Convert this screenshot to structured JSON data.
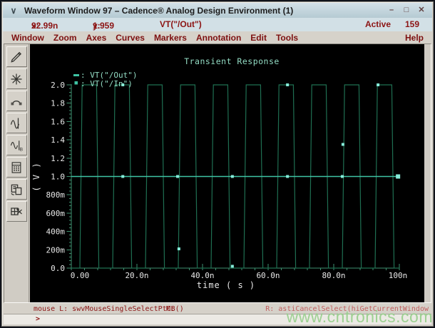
{
  "window": {
    "title": "Waveform Window 97 – Cadence® Analog Design Environment (1)",
    "controls": {
      "menu": "∨",
      "minimize": "–",
      "maximize": "□",
      "close": "✕"
    }
  },
  "readout": {
    "x_label": "x:",
    "x_value": "92.99n",
    "y_label": "y:",
    "y_value": "1.959",
    "signal": "VT(\"/Out\")",
    "active_label": "Active",
    "active_count": "159"
  },
  "menubar": {
    "items": [
      "Window",
      "Zoom",
      "Axes",
      "Curves",
      "Markers",
      "Annotation",
      "Edit",
      "Tools"
    ],
    "help": "Help"
  },
  "toolbar": {
    "icons": [
      "probe-pen-icon",
      "zoom-fit-star-icon",
      "strip-mode-icon",
      "marker-wave-icon",
      "spectrum-sine-b-icon",
      "calculator-icon",
      "copy-window-icon",
      "delete-subwindow-icon"
    ]
  },
  "statusbar": {
    "left": "mouse L: swvMouseSingleSelectPtCB()",
    "middle": "M:",
    "right": "R: astiCancelSelect(hiGetCurrentWindow"
  },
  "prompt": ">",
  "watermark": "www.cntronics.com",
  "chart_data": {
    "type": "line",
    "title": "Transient Response",
    "xlabel": "time ( s )",
    "ylabel": "( V )",
    "x_unit": "ns",
    "xlim": [
      0,
      100
    ],
    "ylim": [
      0.0,
      2.0
    ],
    "xtick_labels": [
      "0.00",
      "20.0n",
      "40.0n",
      "60.0n",
      "80.0n",
      "100n"
    ],
    "xtick_values_ns": [
      0,
      20,
      40,
      60,
      80,
      100
    ],
    "minor_xtick_step_ns": 4,
    "ytick_labels": [
      "2.0",
      "1.8",
      "1.6",
      "1.4",
      "1.2",
      "1.0",
      "800m",
      "600m",
      "400m",
      "200m",
      "0.0"
    ],
    "ytick_values_v": [
      2.0,
      1.8,
      1.6,
      1.4,
      1.2,
      1.0,
      0.8,
      0.6,
      0.4,
      0.2,
      0.0
    ],
    "minor_ytick_step_v": 0.04,
    "grid": false,
    "legend_position": "top-left",
    "colors": {
      "background": "#000000",
      "axis": "#3e916f",
      "out_trace": "#1f6f52",
      "in_trace": "#3fc4a4",
      "point_marker": "#86ecd9",
      "plot_text": "#93dcc4",
      "tick_text": "#e8e8e8"
    },
    "series": [
      {
        "name": "VT(\"/Out\")",
        "legend_marker": "dash",
        "shape": "square-wave",
        "period_ns": 10,
        "rise_start_ns": 2.6,
        "edge_ns": 0.7,
        "high_ns": 4.4,
        "v_low": 0.0,
        "v_high": 2.0,
        "marker_points": [
          {
            "t_ns": 15.7,
            "v": 2.0
          },
          {
            "t_ns": 32.8,
            "v": 0.21
          },
          {
            "t_ns": 49.1,
            "v": 0.02
          },
          {
            "t_ns": 65.9,
            "v": 2.0
          },
          {
            "t_ns": 82.8,
            "v": 1.35
          },
          {
            "t_ns": 93.5,
            "v": 2.0
          }
        ]
      },
      {
        "name": "VT(\"/In\")",
        "legend_marker": "square",
        "shape": "constant",
        "level_v": 1.0,
        "marker_points": [
          {
            "t_ns": 15.7,
            "v": 1.0
          },
          {
            "t_ns": 32.4,
            "v": 1.0
          },
          {
            "t_ns": 49.1,
            "v": 1.0
          },
          {
            "t_ns": 65.9,
            "v": 1.0
          },
          {
            "t_ns": 82.6,
            "v": 1.0
          },
          {
            "t_ns": 99.6,
            "v": 1.0
          }
        ]
      }
    ]
  }
}
